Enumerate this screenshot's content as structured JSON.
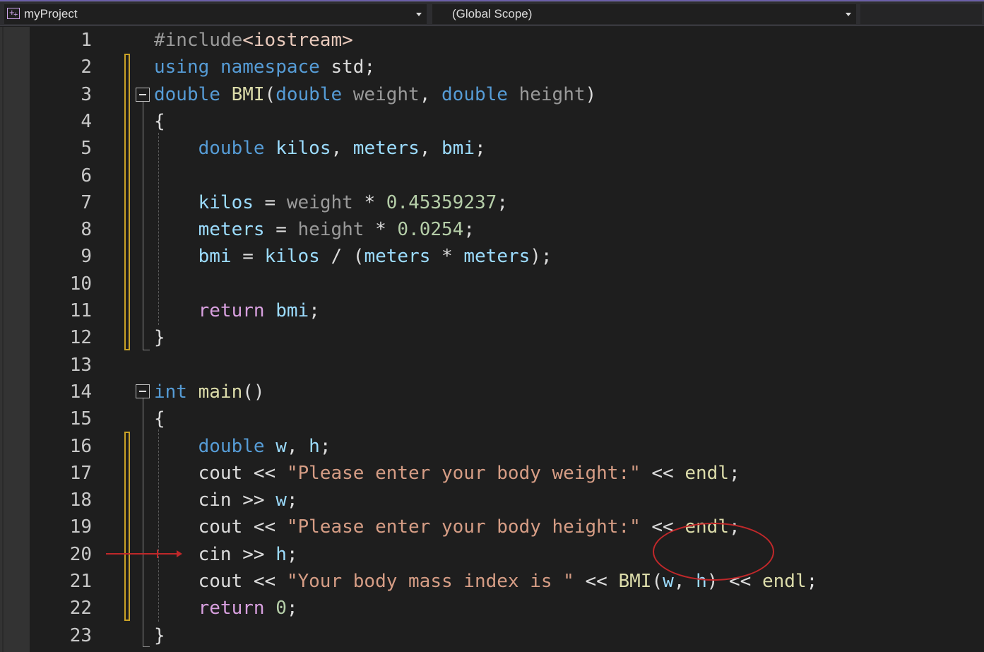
{
  "navbar": {
    "project": "myProject",
    "project_icon": "cpp-project-icon",
    "scope": "(Global Scope)"
  },
  "colors": {
    "keyword": "#569cd6",
    "control": "#d8a0df",
    "function": "#dcdcaa",
    "variable": "#9cdcfe",
    "parameter": "#9a9a9a",
    "number": "#b5cea8",
    "string": "#d69d85",
    "annotation": "#c0282a"
  },
  "lines": [
    {
      "n": "1",
      "tokens": [
        [
          "#include",
          "inc"
        ],
        [
          "<iostream>",
          "hdr"
        ]
      ]
    },
    {
      "n": "2",
      "tokens": [
        [
          "using",
          "kw"
        ],
        [
          " ",
          "plain"
        ],
        [
          "namespace",
          "kw"
        ],
        [
          " std;",
          "plain"
        ]
      ]
    },
    {
      "n": "3",
      "tokens": [
        [
          "double",
          "kw"
        ],
        [
          " ",
          "plain"
        ],
        [
          "BMI",
          "fn"
        ],
        [
          "(",
          "plain"
        ],
        [
          "double",
          "kw"
        ],
        [
          " ",
          "plain"
        ],
        [
          "weight",
          "param"
        ],
        [
          ", ",
          "plain"
        ],
        [
          "double",
          "kw"
        ],
        [
          " ",
          "plain"
        ],
        [
          "height",
          "param"
        ],
        [
          ")",
          "plain"
        ]
      ]
    },
    {
      "n": "4",
      "tokens": [
        [
          "{",
          "plain"
        ]
      ]
    },
    {
      "n": "5",
      "tokens": [
        [
          "    ",
          "plain"
        ],
        [
          "double",
          "kw"
        ],
        [
          " ",
          "plain"
        ],
        [
          "kilos",
          "var"
        ],
        [
          ", ",
          "plain"
        ],
        [
          "meters",
          "var"
        ],
        [
          ", ",
          "plain"
        ],
        [
          "bmi",
          "var"
        ],
        [
          ";",
          "plain"
        ]
      ]
    },
    {
      "n": "6",
      "tokens": []
    },
    {
      "n": "7",
      "tokens": [
        [
          "    ",
          "plain"
        ],
        [
          "kilos",
          "var"
        ],
        [
          " = ",
          "plain"
        ],
        [
          "weight",
          "param"
        ],
        [
          " * ",
          "plain"
        ],
        [
          "0.45359237",
          "num"
        ],
        [
          ";",
          "plain"
        ]
      ]
    },
    {
      "n": "8",
      "tokens": [
        [
          "    ",
          "plain"
        ],
        [
          "meters",
          "var"
        ],
        [
          " = ",
          "plain"
        ],
        [
          "height",
          "param"
        ],
        [
          " * ",
          "plain"
        ],
        [
          "0.0254",
          "num"
        ],
        [
          ";",
          "plain"
        ]
      ]
    },
    {
      "n": "9",
      "tokens": [
        [
          "    ",
          "plain"
        ],
        [
          "bmi",
          "var"
        ],
        [
          " = ",
          "plain"
        ],
        [
          "kilos",
          "var"
        ],
        [
          " / (",
          "plain"
        ],
        [
          "meters",
          "var"
        ],
        [
          " * ",
          "plain"
        ],
        [
          "meters",
          "var"
        ],
        [
          ");",
          "plain"
        ]
      ]
    },
    {
      "n": "10",
      "tokens": []
    },
    {
      "n": "11",
      "tokens": [
        [
          "    ",
          "plain"
        ],
        [
          "return",
          "ctrl"
        ],
        [
          " ",
          "plain"
        ],
        [
          "bmi",
          "var"
        ],
        [
          ";",
          "plain"
        ]
      ]
    },
    {
      "n": "12",
      "tokens": [
        [
          "}",
          "plain"
        ]
      ]
    },
    {
      "n": "13",
      "tokens": []
    },
    {
      "n": "14",
      "tokens": [
        [
          "int",
          "kw"
        ],
        [
          " ",
          "plain"
        ],
        [
          "main",
          "fn"
        ],
        [
          "()",
          "plain"
        ]
      ]
    },
    {
      "n": "15",
      "tokens": [
        [
          "{",
          "plain"
        ]
      ]
    },
    {
      "n": "16",
      "tokens": [
        [
          "    ",
          "plain"
        ],
        [
          "double",
          "kw"
        ],
        [
          " ",
          "plain"
        ],
        [
          "w",
          "var"
        ],
        [
          ", ",
          "plain"
        ],
        [
          "h",
          "var"
        ],
        [
          ";",
          "plain"
        ]
      ]
    },
    {
      "n": "17",
      "tokens": [
        [
          "    cout << ",
          "plain"
        ],
        [
          "\"Please enter your body weight:\"",
          "str"
        ],
        [
          " << ",
          "plain"
        ],
        [
          "endl",
          "fn"
        ],
        [
          ";",
          "plain"
        ]
      ]
    },
    {
      "n": "18",
      "tokens": [
        [
          "    cin >> ",
          "plain"
        ],
        [
          "w",
          "var"
        ],
        [
          ";",
          "plain"
        ]
      ]
    },
    {
      "n": "19",
      "tokens": [
        [
          "    cout << ",
          "plain"
        ],
        [
          "\"Please enter your body height:\"",
          "str"
        ],
        [
          " << ",
          "plain"
        ],
        [
          "endl",
          "fn"
        ],
        [
          ";",
          "plain"
        ]
      ]
    },
    {
      "n": "20",
      "tokens": [
        [
          "    cin >> ",
          "plain"
        ],
        [
          "h",
          "var"
        ],
        [
          ";",
          "plain"
        ]
      ]
    },
    {
      "n": "21",
      "tokens": [
        [
          "    cout << ",
          "plain"
        ],
        [
          "\"Your body mass index is \"",
          "str"
        ],
        [
          " << ",
          "plain"
        ],
        [
          "BMI",
          "fn"
        ],
        [
          "(",
          "plain"
        ],
        [
          "w",
          "var"
        ],
        [
          ", ",
          "plain"
        ],
        [
          "h",
          "var"
        ],
        [
          ")",
          "plain"
        ],
        [
          " << ",
          "plain"
        ],
        [
          "endl",
          "fn"
        ],
        [
          ";",
          "plain"
        ]
      ]
    },
    {
      "n": "22",
      "tokens": [
        [
          "    ",
          "plain"
        ],
        [
          "return",
          "ctrl"
        ],
        [
          " ",
          "plain"
        ],
        [
          "0",
          "num"
        ],
        [
          ";",
          "plain"
        ]
      ]
    },
    {
      "n": "23",
      "tokens": [
        [
          "}",
          "plain"
        ]
      ]
    }
  ]
}
